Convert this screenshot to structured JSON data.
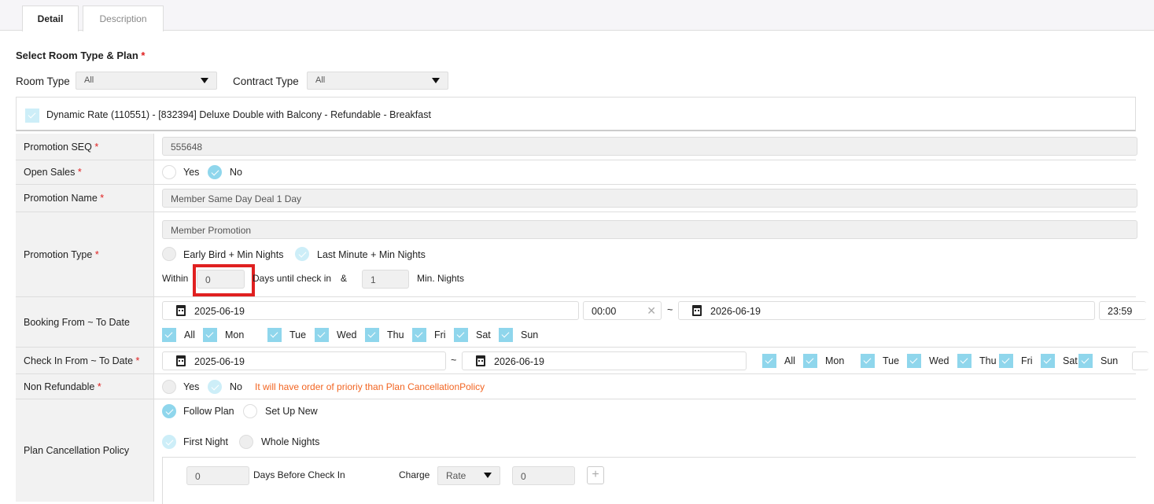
{
  "tabs": [
    {
      "label": "Detail",
      "active": true
    },
    {
      "label": "Description",
      "active": false
    }
  ],
  "section_title": "Select Room Type & Plan",
  "required_mark": "*",
  "filters": {
    "room_type_label": "Room Type",
    "room_type_value": "All",
    "contract_type_label": "Contract Type",
    "contract_type_value": "All"
  },
  "plan": {
    "label": "Dynamic Rate (110551) - [832394] Deluxe Double with Balcony - Refundable - Breakfast",
    "checked": true
  },
  "form": {
    "promotion_seq": {
      "label": "Promotion SEQ",
      "value": "555648"
    },
    "open_sales": {
      "label": "Open Sales",
      "yes": "Yes",
      "no": "No",
      "selected": "No"
    },
    "promotion_name": {
      "label": "Promotion Name",
      "value": "Member Same Day Deal 1 Day"
    },
    "promotion_type": {
      "label": "Promotion Type",
      "value": "Member Promotion",
      "opt1": "Early Bird + Min Nights",
      "opt2": "Last Minute + Min Nights",
      "selected": "Last Minute + Min Nights",
      "within": "Within",
      "within_value": "0",
      "days_until": "Days until check in",
      "amp": "&",
      "min_nights_value": "1",
      "min_nights": "Min. Nights"
    },
    "booking": {
      "label": "Booking From ~ To Date",
      "from_date": "2025-06-19",
      "from_time": "00:00",
      "sep": "~",
      "to_date": "2026-06-19",
      "to_time": "23:59",
      "days": [
        "All",
        "Mon",
        "Tue",
        "Wed",
        "Thu",
        "Fri",
        "Sat",
        "Sun"
      ]
    },
    "checkin": {
      "label": "Check In From ~ To Date",
      "from_date": "2025-06-19",
      "sep": "~",
      "to_date": "2026-06-19",
      "days": [
        "All",
        "Mon",
        "Tue",
        "Wed",
        "Thu",
        "Fri",
        "Sat",
        "Sun"
      ]
    },
    "non_refundable": {
      "label": "Non Refundable",
      "yes": "Yes",
      "no": "No",
      "selected": "No",
      "note": "It will have order of prioriy than Plan CancellationPolicy"
    },
    "cancellation": {
      "label": "Plan Cancellation Policy",
      "follow": "Follow Plan",
      "setup": "Set Up New",
      "first_night": "First Night",
      "whole_nights": "Whole Nights",
      "days_value": "0",
      "days_before": "Days Before Check In",
      "charge": "Charge",
      "charge_type": "Rate",
      "charge_value": "0",
      "add": "+"
    }
  },
  "colors": {
    "accent": "#8fd6ec",
    "note": "#f26522",
    "highlight": "#e02020"
  }
}
